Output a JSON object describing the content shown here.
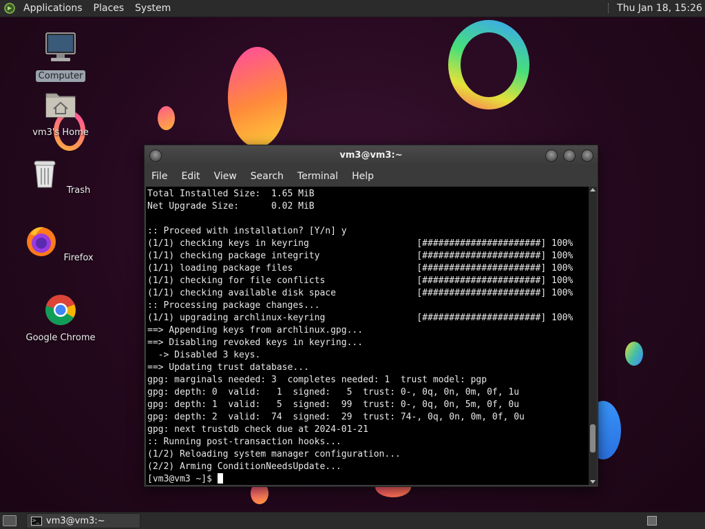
{
  "top_panel": {
    "menus": [
      "Applications",
      "Places",
      "System"
    ],
    "clock": "Thu Jan 18, 15:26"
  },
  "desktop_icons": [
    {
      "label": "Computer",
      "icon": "computer-icon"
    },
    {
      "label": "vm3's Home",
      "icon": "home-folder-icon"
    },
    {
      "label": "Trash",
      "icon": "trash-icon"
    },
    {
      "label": "Firefox",
      "icon": "firefox-icon"
    },
    {
      "label": "Google Chrome",
      "icon": "chrome-icon"
    }
  ],
  "terminal": {
    "title": "vm3@vm3:~",
    "menus": [
      "File",
      "Edit",
      "View",
      "Search",
      "Terminal",
      "Help"
    ],
    "lines": [
      "Total Installed Size:  1.65 MiB",
      "Net Upgrade Size:      0.02 MiB",
      "",
      ":: Proceed with installation? [Y/n] y",
      "(1/1) checking keys in keyring                    [######################] 100%",
      "(1/1) checking package integrity                  [######################] 100%",
      "(1/1) loading package files                       [######################] 100%",
      "(1/1) checking for file conflicts                 [######################] 100%",
      "(1/1) checking available disk space               [######################] 100%",
      ":: Processing package changes...",
      "(1/1) upgrading archlinux-keyring                 [######################] 100%",
      "==> Appending keys from archlinux.gpg...",
      "==> Disabling revoked keys in keyring...",
      "  -> Disabled 3 keys.",
      "==> Updating trust database...",
      "gpg: marginals needed: 3  completes needed: 1  trust model: pgp",
      "gpg: depth: 0  valid:   1  signed:   5  trust: 0-, 0q, 0n, 0m, 0f, 1u",
      "gpg: depth: 1  valid:   5  signed:  99  trust: 0-, 0q, 0n, 5m, 0f, 0u",
      "gpg: depth: 2  valid:  74  signed:  29  trust: 74-, 0q, 0n, 0m, 0f, 0u",
      "gpg: next trustdb check due at 2024-01-21",
      ":: Running post-transaction hooks...",
      "(1/2) Reloading system manager configuration...",
      "(2/2) Arming ConditionNeedsUpdate..."
    ],
    "prompt": "[vm3@vm3 ~]$ ",
    "scroll_position": 0.9,
    "scroll_visible_fraction": 0.1
  },
  "taskbar": {
    "window_button": "vm3@vm3:~"
  },
  "colors": {
    "terminal_bg": "#000000",
    "terminal_fg": "#e8e8e8",
    "panel_bg": "#2b2b2b"
  }
}
